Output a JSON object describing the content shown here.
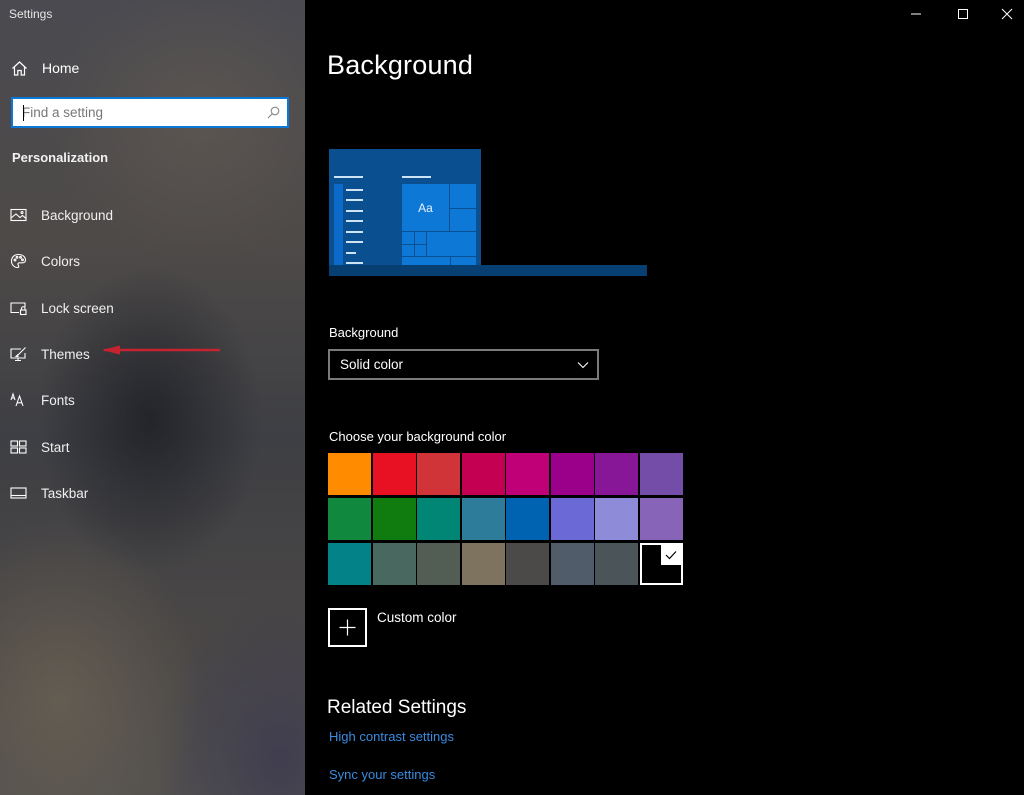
{
  "window": {
    "title": "Settings",
    "controls": {
      "minimize": "minimize",
      "maximize": "maximize",
      "close": "close"
    }
  },
  "sidebar": {
    "home": {
      "label": "Home",
      "icon": "home-icon"
    },
    "search": {
      "placeholder": "Find a setting",
      "value": "",
      "icon": "search-icon"
    },
    "section_title": "Personalization",
    "items": [
      {
        "label": "Background",
        "icon": "picture-icon",
        "selected": true
      },
      {
        "label": "Colors",
        "icon": "palette-icon"
      },
      {
        "label": "Lock screen",
        "icon": "lock-screen-icon"
      },
      {
        "label": "Themes",
        "icon": "themes-icon"
      },
      {
        "label": "Fonts",
        "icon": "fonts-icon"
      },
      {
        "label": "Start",
        "icon": "start-icon"
      },
      {
        "label": "Taskbar",
        "icon": "taskbar-icon"
      }
    ],
    "annotation": {
      "type": "red-arrow",
      "points_to": "Themes",
      "color": "#c4232f"
    }
  },
  "main": {
    "title": "Background",
    "preview": {
      "tile_text": "Aa",
      "window_color": "#0a4f8f",
      "tile_color": "#0e78d7",
      "taskbar_color": "#073f72"
    },
    "background_label": "Background",
    "background_select": {
      "selected": "Solid color"
    },
    "choose_color_label": "Choose your background color",
    "swatches": [
      {
        "color": "#ff8c00"
      },
      {
        "color": "#e81123"
      },
      {
        "color": "#d13438"
      },
      {
        "color": "#c30052"
      },
      {
        "color": "#bf0077"
      },
      {
        "color": "#9a0089"
      },
      {
        "color": "#881798"
      },
      {
        "color": "#744da9"
      },
      {
        "color": "#10893e"
      },
      {
        "color": "#107c10"
      },
      {
        "color": "#018574"
      },
      {
        "color": "#2d7d9a"
      },
      {
        "color": "#0063b1"
      },
      {
        "color": "#6b69d6"
      },
      {
        "color": "#8e8cd8"
      },
      {
        "color": "#8764b8"
      },
      {
        "color": "#038387"
      },
      {
        "color": "#486860"
      },
      {
        "color": "#525e54"
      },
      {
        "color": "#7e735f"
      },
      {
        "color": "#4c4a48"
      },
      {
        "color": "#515c6b"
      },
      {
        "color": "#4a5459"
      },
      {
        "color": "#000000",
        "selected": true
      }
    ],
    "custom_color_label": "Custom color",
    "related_title": "Related Settings",
    "links": [
      {
        "label": "High contrast settings"
      },
      {
        "label": "Sync your settings"
      }
    ],
    "link_color": "#3a8be0"
  }
}
